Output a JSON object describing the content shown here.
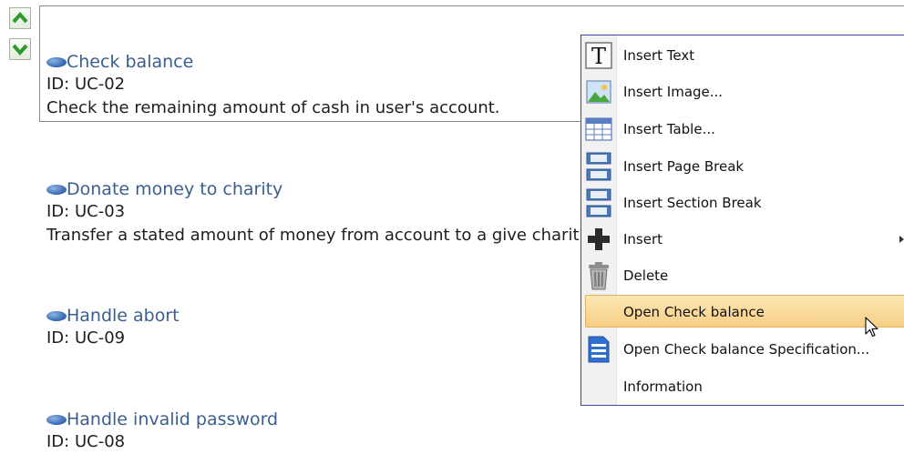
{
  "use_cases": [
    {
      "name": "Check balance",
      "id": "ID: UC-02",
      "description": "Check the remaining amount of cash in user's account."
    },
    {
      "name": "Donate money to charity",
      "id": "ID: UC-03",
      "description": "Transfer a stated amount of money from account to a give charit"
    },
    {
      "name": "Handle abort",
      "id": "ID: UC-09"
    },
    {
      "name": "Handle invalid password",
      "id": "ID: UC-08"
    }
  ],
  "context_menu": {
    "items": [
      {
        "label": "Insert Text",
        "icon": "text-icon"
      },
      {
        "label": "Insert Image...",
        "icon": "image-icon"
      },
      {
        "label": "Insert Table...",
        "icon": "table-icon"
      },
      {
        "label": "Insert Page Break",
        "icon": "page-break-icon"
      },
      {
        "label": "Insert Section Break",
        "icon": "section-break-icon"
      },
      {
        "label": "Insert",
        "icon": "plus-icon",
        "has_submenu": true
      },
      {
        "label": "Delete",
        "icon": "trash-icon"
      },
      {
        "label": "Open Check balance",
        "icon": "",
        "highlighted": true
      },
      {
        "label": "Open Check balance Specification...",
        "icon": "specification-icon"
      },
      {
        "label": "Information",
        "icon": ""
      }
    ]
  },
  "colors": {
    "use_case_title": "#3a5f8f",
    "menu_border": "#3a4aa0",
    "highlight": "#f7cf86",
    "arrow_green": "#2e9a2e"
  }
}
